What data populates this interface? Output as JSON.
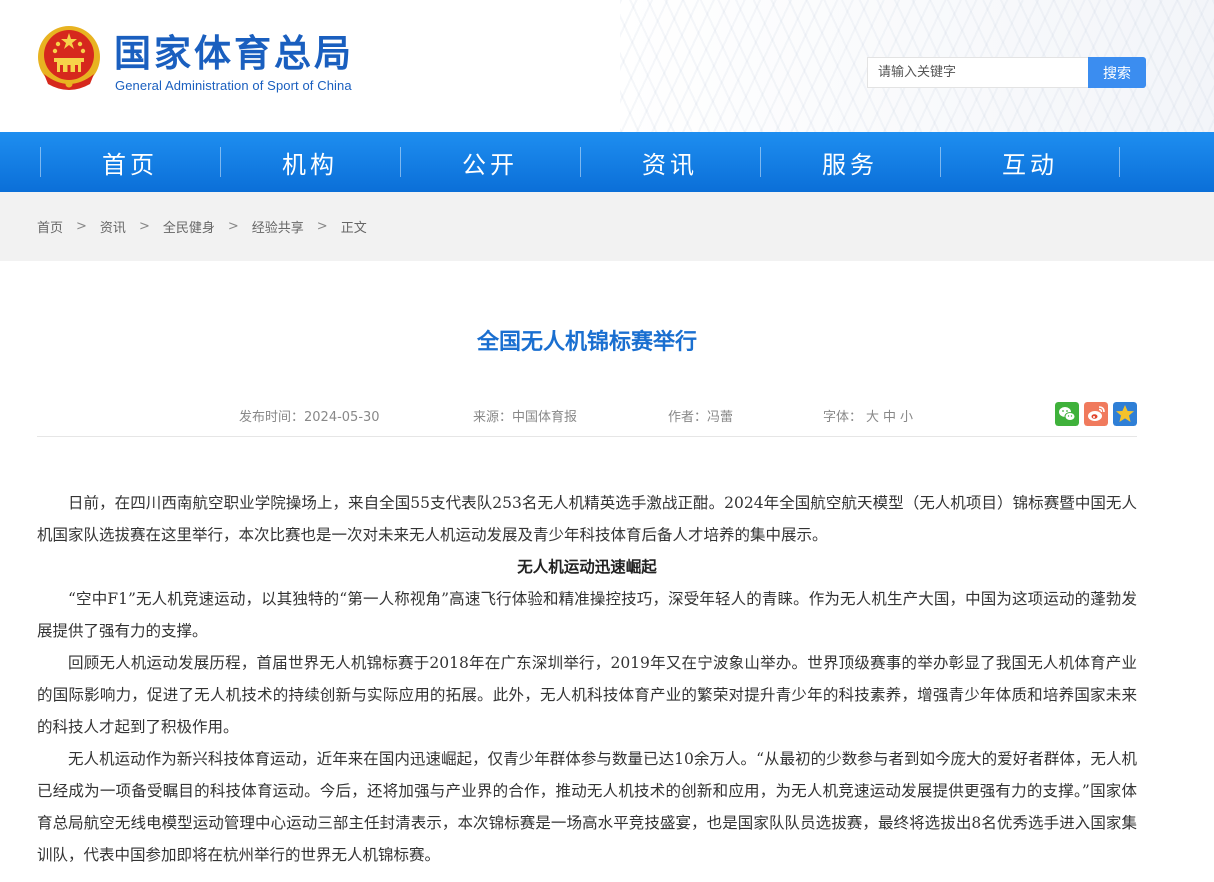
{
  "header": {
    "title": "国家体育总局",
    "subtitle": "General Administration of Sport of China",
    "search_placeholder": "请输入关键字",
    "search_button": "搜索"
  },
  "nav": {
    "items": [
      "首页",
      "机构",
      "公开",
      "资讯",
      "服务",
      "互动"
    ]
  },
  "breadcrumb": {
    "items": [
      "首页",
      "资讯",
      "全民健身",
      "经验共享"
    ],
    "separator": ">",
    "current": "正文"
  },
  "article": {
    "title": "全国无人机锦标赛举行",
    "publish_time": "发布时间：2024-05-30",
    "source": "来源：中国体育报",
    "author": "作者：冯蕾",
    "font_label": "字体：",
    "font_sizes": [
      "大",
      "中",
      "小"
    ],
    "share_icons": [
      "wechat-icon",
      "weibo-icon",
      "favorite-icon"
    ],
    "paragraphs": [
      "日前，在四川西南航空职业学院操场上，来自全国55支代表队253名无人机精英选手激战正酣。2024年全国航空航天模型（无人机项目）锦标赛暨中国无人机国家队选拔赛在这里举行，本次比赛也是一次对未来无人机运动发展及青少年科技体育后备人才培养的集中展示。",
      "“空中F1”无人机竞速运动，以其独特的“第一人称视角”高速飞行体验和精准操控技巧，深受年轻人的青睐。作为无人机生产大国，中国为这项运动的蓬勃发展提供了强有力的支撑。",
      "回顾无人机运动发展历程，首届世界无人机锦标赛于2018年在广东深圳举行，2019年又在宁波象山举办。世界顶级赛事的举办彰显了我国无人机体育产业的国际影响力，促进了无人机技术的持续创新与实际应用的拓展。此外，无人机科技体育产业的繁荣对提升青少年的科技素养，增强青少年体质和培养国家未来的科技人才起到了积极作用。",
      "无人机运动作为新兴科技体育运动，近年来在国内迅速崛起，仅青少年群体参与数量已达10余万人。“从最初的少数参与者到如今庞大的爱好者群体，无人机已经成为一项备受瞩目的科技体育运动。今后，还将加强与产业界的合作，推动无人机技术的创新和应用，为无人机竞速运动发展提供更强有力的支撑。”国家体育总局航空无线电模型运动管理中心运动三部主任封清表示，本次锦标赛是一场高水平竞技盛宴，也是国家队队员选拔赛，最终将选拔出8名优秀选手进入国家集训队，代表中国参加即将在杭州举行的世界无人机锦标赛。"
    ],
    "subheading": "无人机运动迅速崛起"
  },
  "colors": {
    "brand_blue": "#1a5fbf",
    "nav_blue": "#1e8ef0",
    "title_blue": "#1a6fd0",
    "search_button": "#3b8df0"
  }
}
